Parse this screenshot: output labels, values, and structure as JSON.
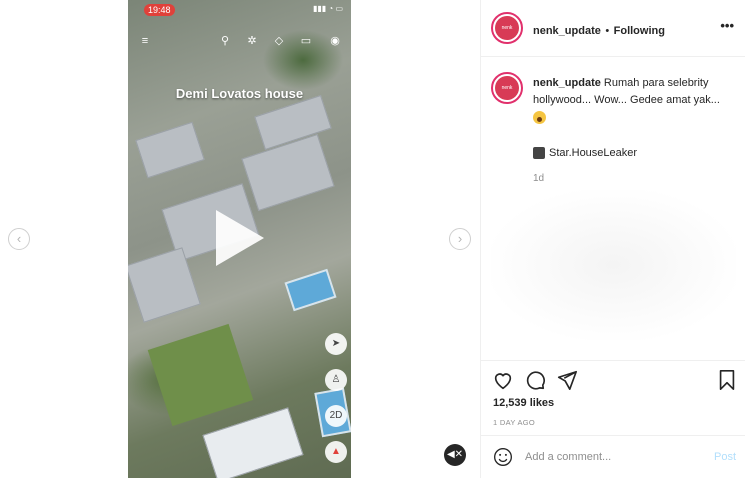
{
  "video": {
    "status_time": "19:48",
    "caption_overlay": "Demi Lovatos house",
    "map_controls": [
      "2D"
    ]
  },
  "header": {
    "username": "nenk_update",
    "separator": "•",
    "follow_status": "Following",
    "more_label": "•••"
  },
  "caption": {
    "username": "nenk_update",
    "text": "Rumah para selebrity hollywood... Wow... Gedee amat yak...",
    "credit": "Star.HouseLeaker",
    "age": "1d"
  },
  "stats": {
    "likes": "12,539 likes",
    "posted": "1 DAY AGO"
  },
  "comment": {
    "placeholder": "Add a comment...",
    "post_label": "Post"
  },
  "colors": {
    "accent_link": "#b2dffc",
    "story_ring": "#e1306c",
    "text": "#262626",
    "muted": "#8e8e8e"
  },
  "icons": {
    "like": "heart-icon",
    "comment": "comment-icon",
    "share": "send-icon",
    "save": "bookmark-icon",
    "emoji": "smiley-icon",
    "mute": "speaker-muted-icon"
  }
}
